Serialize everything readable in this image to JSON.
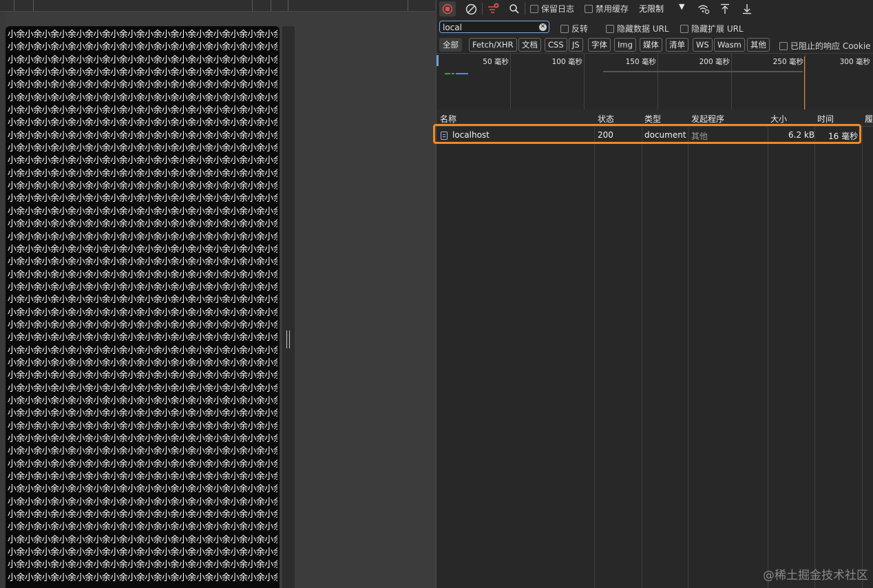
{
  "page": {
    "text_line": "小余小余小余小余小余小余小余小余小余小余小余小余小余小余小余小余",
    "line_count": 44
  },
  "toolbar": {
    "record_icon": "record-stop-icon",
    "clear_icon": "clear-icon",
    "filter_icon": "filter-icon",
    "search_icon": "search-icon",
    "preserve_log": "保留日志",
    "disable_cache": "禁用缓存",
    "throttling": "无限制",
    "throttle_arrow": "▼",
    "network_conditions_icon": "wifi-settings-icon",
    "import_icon": "upload-icon",
    "export_icon": "download-icon"
  },
  "filter": {
    "value": "local",
    "invert": "反转",
    "hide_data_urls": "隐藏数据 URL",
    "hide_extension_urls": "隐藏扩展 URL"
  },
  "types": [
    "全部",
    "Fetch/XHR",
    "文档",
    "CSS",
    "JS",
    "字体",
    "Img",
    "媒体",
    "清单",
    "WS",
    "Wasm",
    "其他"
  ],
  "blocked_cookies": "已阻止的响应 Cookie",
  "overview": {
    "labels": [
      "50 毫秒",
      "100 毫秒",
      "150 毫秒",
      "200 毫秒",
      "250 毫秒",
      "300 毫秒"
    ]
  },
  "table": {
    "headers": {
      "name": "名称",
      "status": "状态",
      "type": "类型",
      "initiator": "发起程序",
      "size": "大小",
      "time": "时间",
      "more": "履"
    },
    "rows": [
      {
        "name": "localhost",
        "status": "200",
        "type": "document",
        "initiator": "其他",
        "size": "6.2 kB",
        "time": "16 毫秒"
      }
    ]
  },
  "colors": {
    "highlight": "#f08a24",
    "record_red": "#e0504a",
    "timeline_blue": "#4a8fe0",
    "timeline_green": "#3aa64a",
    "timeline_orange": "#f08a24"
  },
  "watermark": "@稀土掘金技术社区"
}
